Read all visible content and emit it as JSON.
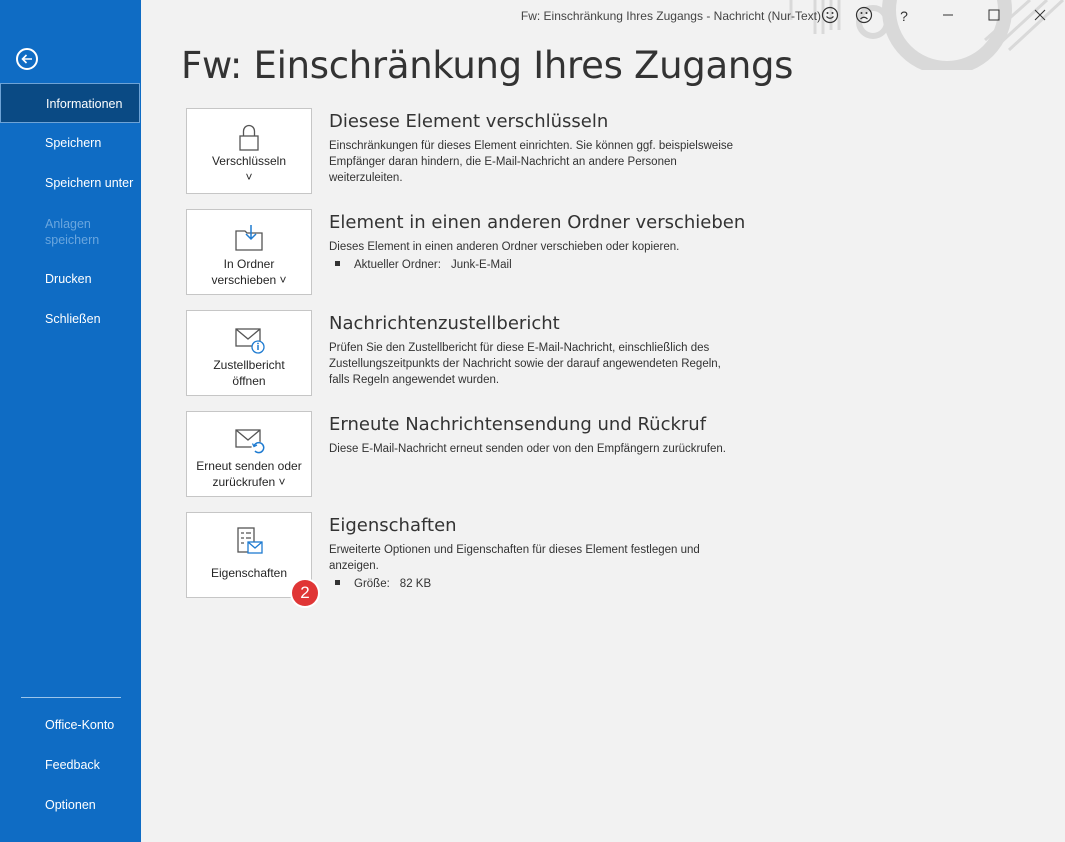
{
  "window": {
    "title": "Fw: Einschränkung Ihres Zugangs  -  Nachricht (Nur-Text)",
    "controls": [
      "smile-icon",
      "frown-icon",
      "help-icon",
      "minimize-icon",
      "maximize-icon",
      "close-icon"
    ],
    "help_label": "?"
  },
  "sidebar": {
    "back_icon": "back-arrow-icon",
    "items": [
      {
        "label": "Informationen",
        "active": true
      },
      {
        "label": "Speichern"
      },
      {
        "label": "Speichern unter"
      },
      {
        "label": "Anlagen speichern",
        "disabled": true
      },
      {
        "label": "Drucken"
      },
      {
        "label": "Schließen"
      }
    ],
    "bottom_items": [
      {
        "label": "Office-Konto"
      },
      {
        "label": "Feedback"
      },
      {
        "label": "Optionen"
      }
    ]
  },
  "main": {
    "title": "Fw: Einschränkung Ihres Zugangs",
    "sections": [
      {
        "tile_label_1": "Verschlüsseln",
        "tile_label_2": "˅",
        "icon": "lock-icon",
        "title": "Diesese Element verschlüsseln",
        "description": "Einschränkungen für dieses Element einrichten. Sie können ggf. beispielsweise Empfänger daran hindern, die E-Mail-Nachricht an andere Personen weiterzuleiten."
      },
      {
        "tile_label_1": "In Ordner",
        "tile_label_2": "verschieben ˅",
        "icon": "move-folder-icon",
        "title": "Element in einen anderen Ordner verschieben",
        "description": "Dieses Element in einen anderen Ordner verschieben oder kopieren.",
        "bullet_label": "Aktueller Ordner:",
        "bullet_value": "Junk-E-Mail"
      },
      {
        "tile_label_1": "Zustellbericht",
        "tile_label_2": "öffnen",
        "icon": "delivery-report-icon",
        "title": "Nachrichtenzustellbericht",
        "description": "Prüfen Sie den Zustellbericht für diese E-Mail-Nachricht, einschließlich des Zustellungszeitpunkts der Nachricht sowie der darauf angewendeten Regeln, falls Regeln angewendet wurden."
      },
      {
        "tile_label_1": "Erneut senden oder",
        "tile_label_2": "zurückrufen ˅",
        "icon": "resend-icon",
        "title": "Erneute Nachrichtensendung und Rückruf",
        "description": "Diese E-Mail-Nachricht erneut senden oder von den Empfängern zurückrufen."
      },
      {
        "tile_label_1": "Eigenschaften",
        "tile_label_2": "",
        "icon": "properties-icon",
        "title": "Eigenschaften",
        "description": "Erweiterte Optionen und Eigenschaften für dieses Element festlegen und anzeigen.",
        "bullet_label": "Größe:",
        "bullet_value": "82 KB"
      }
    ],
    "step_badge": "2"
  },
  "colors": {
    "sidebar": "#0f6cc4",
    "sidebar_active": "#0a4a84",
    "badge": "#e03636",
    "background": "#f2f2f2"
  }
}
